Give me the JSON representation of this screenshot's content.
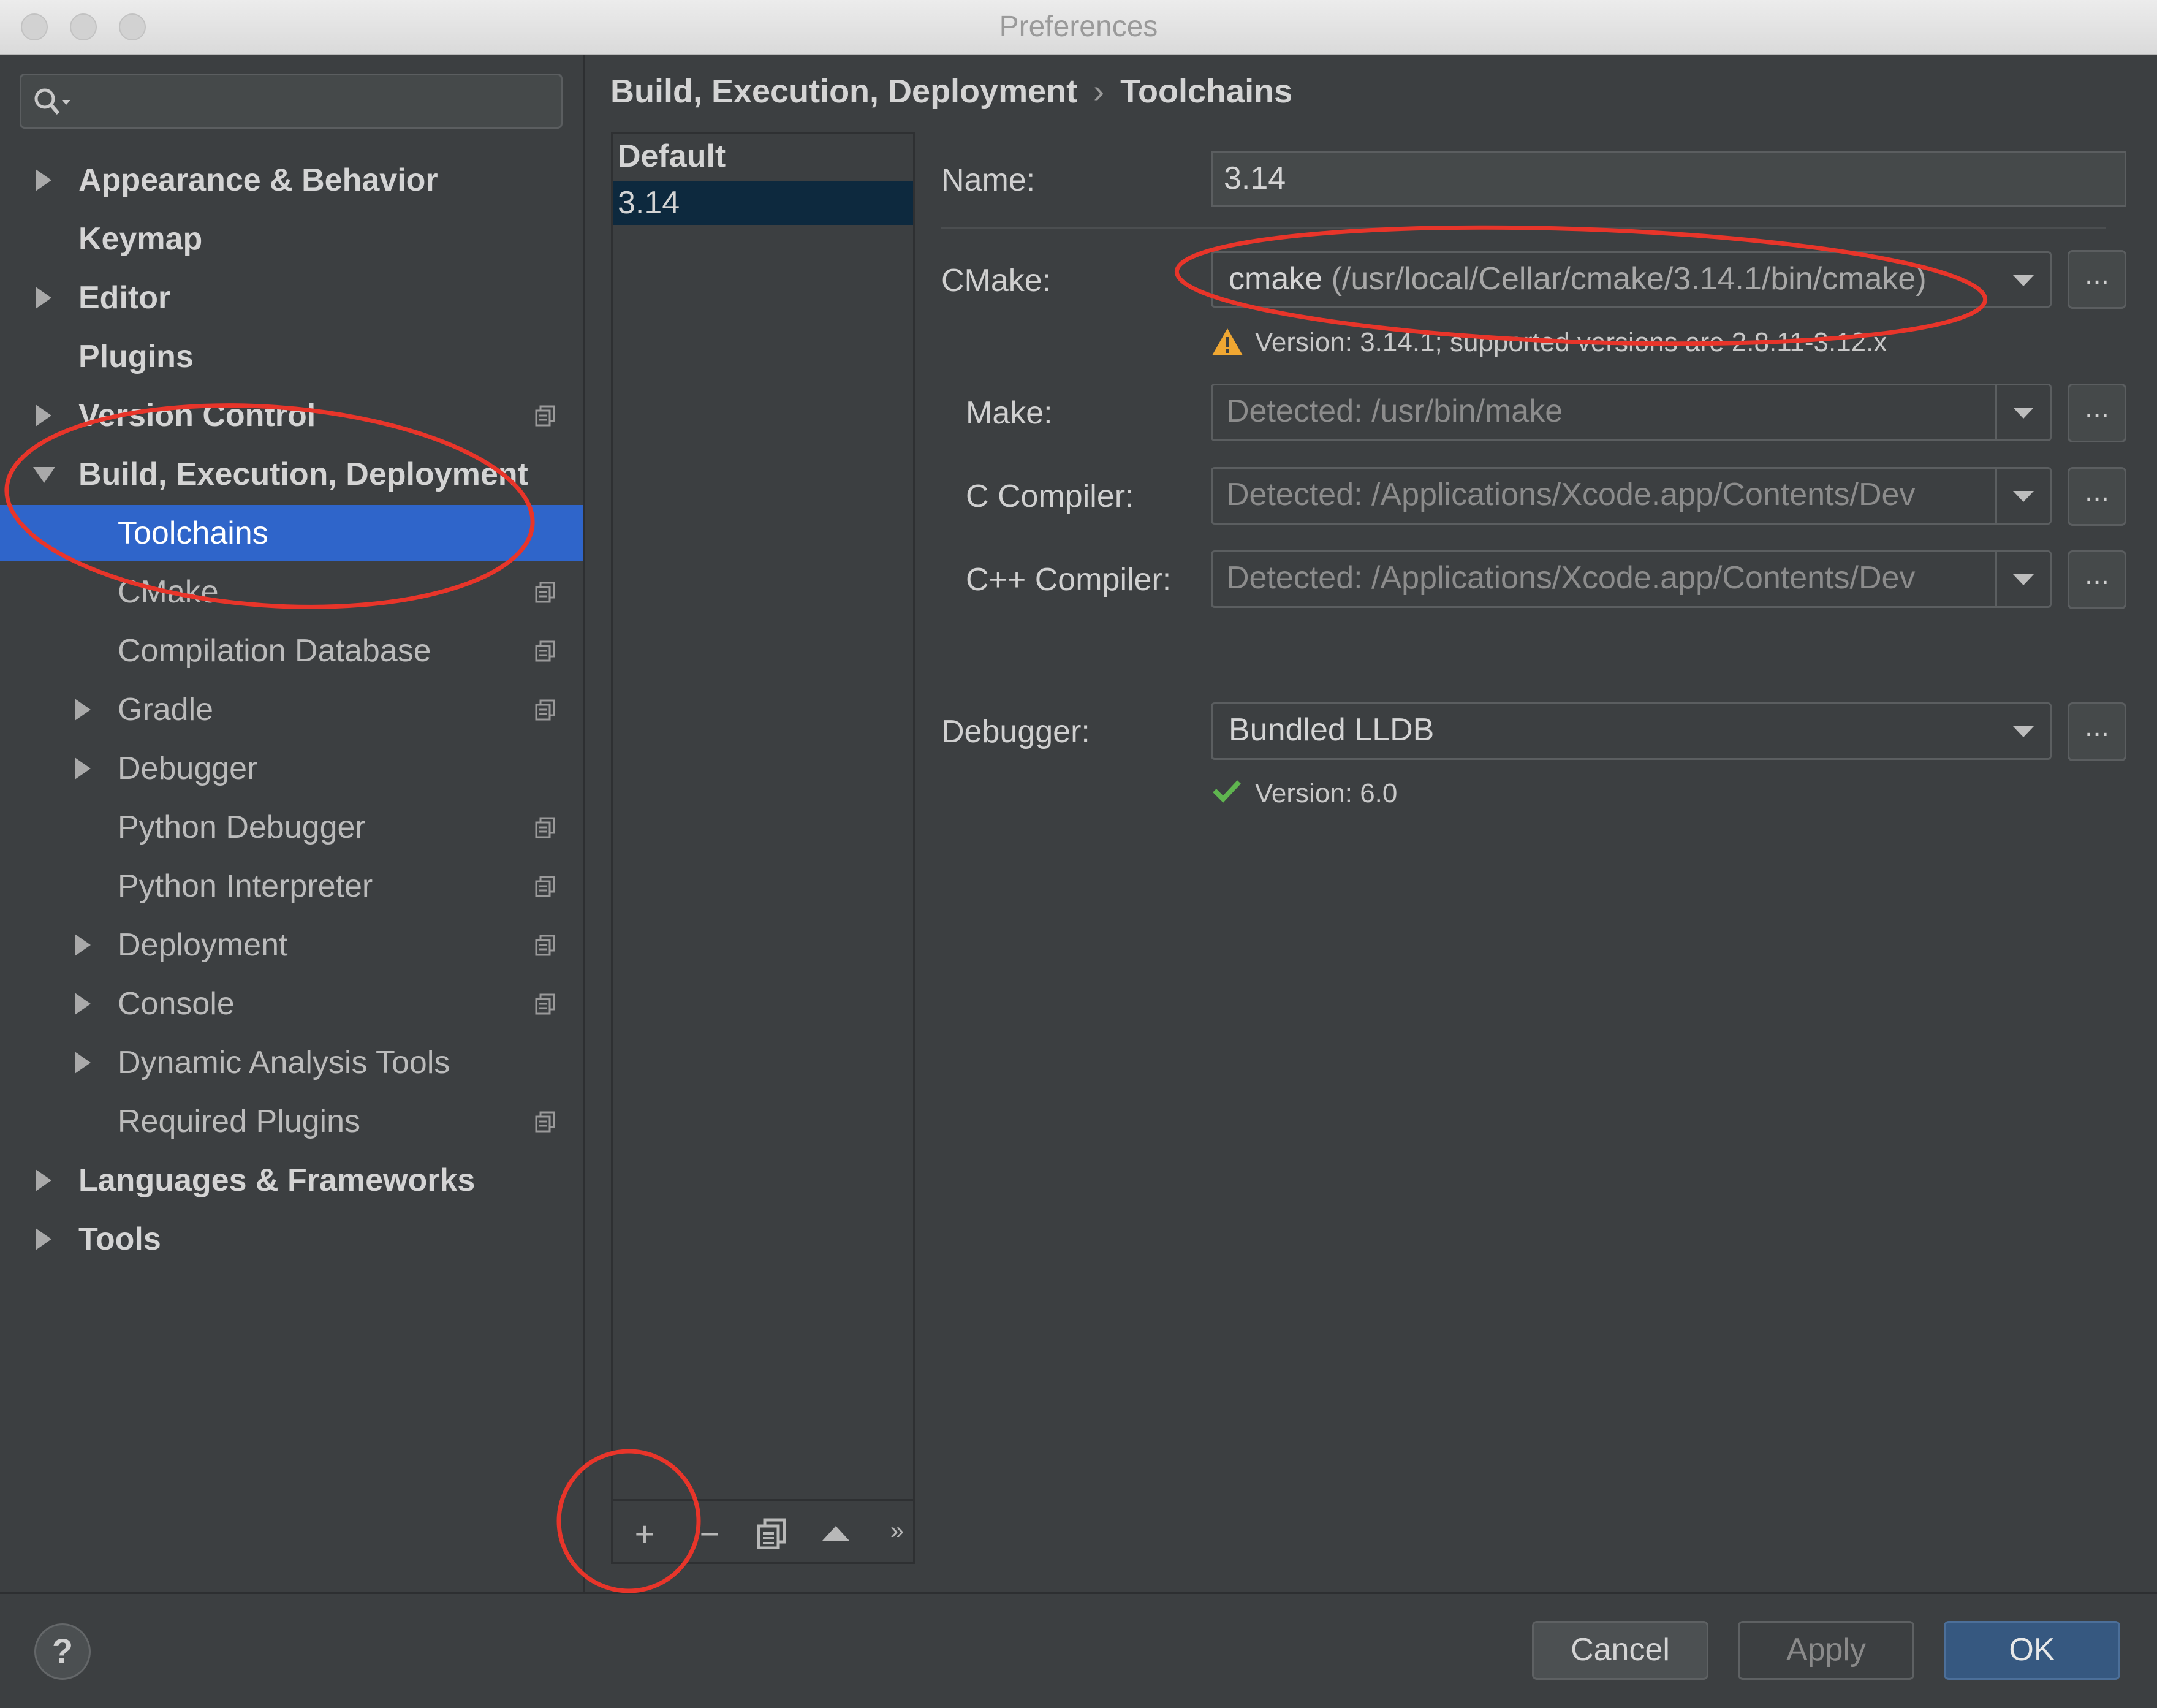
{
  "window": {
    "title": "Preferences"
  },
  "sidebar": {
    "search_placeholder": "",
    "items": [
      {
        "label": "Appearance & Behavior"
      },
      {
        "label": "Keymap"
      },
      {
        "label": "Editor"
      },
      {
        "label": "Plugins"
      },
      {
        "label": "Version Control"
      },
      {
        "label": "Build, Execution, Deployment"
      },
      {
        "label": "Toolchains"
      },
      {
        "label": "CMake"
      },
      {
        "label": "Compilation Database"
      },
      {
        "label": "Gradle"
      },
      {
        "label": "Debugger"
      },
      {
        "label": "Python Debugger"
      },
      {
        "label": "Python Interpreter"
      },
      {
        "label": "Deployment"
      },
      {
        "label": "Console"
      },
      {
        "label": "Dynamic Analysis Tools"
      },
      {
        "label": "Required Plugins"
      },
      {
        "label": "Languages & Frameworks"
      },
      {
        "label": "Tools"
      }
    ],
    "selected": "Toolchains"
  },
  "breadcrumb": {
    "parent": "Build, Execution, Deployment",
    "separator": "›",
    "current": "Toolchains"
  },
  "toolchains": {
    "header": "Default",
    "items": [
      "3.14"
    ],
    "toolbar": {
      "add": "+",
      "remove": "−",
      "more": "»"
    }
  },
  "form": {
    "name_label": "Name:",
    "name_value": "3.14",
    "cmake_label": "CMake:",
    "cmake_value": "cmake",
    "cmake_path": "(/usr/local/Cellar/cmake/3.14.1/bin/cmake)",
    "cmake_warning": "Version: 3.14.1; supported versions are 2.8.11-3.12.x",
    "make_label": "Make:",
    "make_value": "Detected: /usr/bin/make",
    "c_compiler_label": "C Compiler:",
    "c_compiler_value": "Detected: /Applications/Xcode.app/Contents/Dev",
    "cpp_compiler_label": "C++ Compiler:",
    "cpp_compiler_value": "Detected: /Applications/Xcode.app/Contents/Dev",
    "debugger_label": "Debugger:",
    "debugger_value": "Bundled LLDB",
    "debugger_version": "Version: 6.0",
    "browse_label": "..."
  },
  "footer": {
    "help": "?",
    "cancel": "Cancel",
    "apply": "Apply",
    "ok": "OK"
  },
  "colors": {
    "background": "#3c3f41",
    "selection": "#2f65ca",
    "primary_button": "#365880",
    "annotation": "#e8352a",
    "warning": "#f0a732",
    "success": "#5fb54f"
  }
}
